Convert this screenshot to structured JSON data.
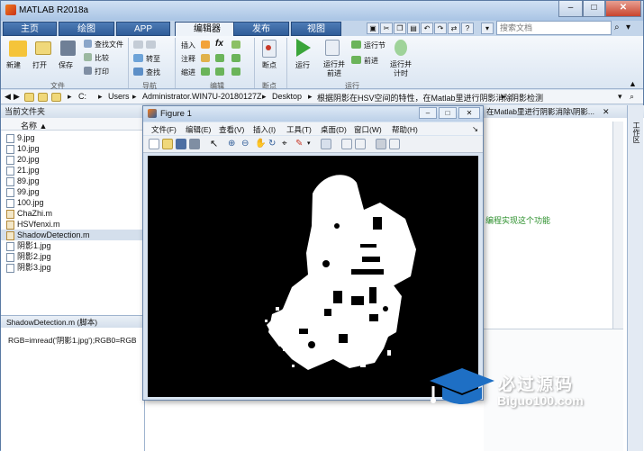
{
  "window": {
    "title": "MATLAB R2018a",
    "min": "–",
    "max": "□",
    "close": "✕"
  },
  "tabs": [
    {
      "label": "主页"
    },
    {
      "label": "绘图"
    },
    {
      "label": "APP"
    },
    {
      "label": "编辑器"
    },
    {
      "label": "发布"
    },
    {
      "label": "视图"
    }
  ],
  "search": {
    "placeholder": "搜索文档"
  },
  "ribbon": {
    "file": {
      "new": "新建",
      "open": "打开",
      "save": "保存",
      "find_files": "查找文件",
      "compare": "比较",
      "print": "打印",
      "group": "文件"
    },
    "navigate": {
      "goto": "转至",
      "find": "查找",
      "group": "导航"
    },
    "edit": {
      "insert": "插入",
      "comment": "注释",
      "indent": "缩进",
      "fx": "fx",
      "group": "编辑"
    },
    "breakpoints": {
      "label": "断点",
      "group": "断点"
    },
    "run": {
      "run": "运行",
      "run_advance": "运行并前进",
      "run_section": "运行节",
      "advance": "前进",
      "run_time": "运行并计时",
      "group": "运行"
    }
  },
  "address": [
    "C:",
    "Users",
    "Administrator.WIN7U-20180127Z",
    "Desktop",
    "根据阴影在HSV空间的特性，在Matlab里进行阴影消除",
    "阴影检测"
  ],
  "current_folder": {
    "header": "当前文件夹",
    "col": "名称 ▲",
    "files": [
      {
        "name": "9.jpg",
        "type": "img"
      },
      {
        "name": "10.jpg",
        "type": "img"
      },
      {
        "name": "20.jpg",
        "type": "img"
      },
      {
        "name": "21.jpg",
        "type": "img"
      },
      {
        "name": "89.jpg",
        "type": "img"
      },
      {
        "name": "99.jpg",
        "type": "img"
      },
      {
        "name": "100.jpg",
        "type": "img"
      },
      {
        "name": "ChaZhi.m",
        "type": "m"
      },
      {
        "name": "HSVfenxi.m",
        "type": "m"
      },
      {
        "name": "ShadowDetection.m",
        "type": "m"
      },
      {
        "name": "阴影1.jpg",
        "type": "img"
      },
      {
        "name": "阴影2.jpg",
        "type": "img"
      },
      {
        "name": "阴影3.jpg",
        "type": "img"
      }
    ],
    "selected": "ShadowDetection.m"
  },
  "details": {
    "header": "ShadowDetection.m  (脚本)",
    "code": "RGB=imread('阴影1.jpg');RGB0=RGB"
  },
  "editor": {
    "tab_path": "在Matlab里进行阴影消除\\阴影...",
    "comment": "编程实现这个功能"
  },
  "side_tab": "工作区",
  "figure": {
    "title": "Figure 1",
    "menu": [
      "文件(F)",
      "编辑(E)",
      "查看(V)",
      "插入(I)",
      "工具(T)",
      "桌面(D)",
      "窗口(W)",
      "帮助(H)"
    ]
  },
  "watermark": {
    "line1": "必过源码",
    "line2": "Biguo100.com"
  },
  "colors": {
    "accent": "#2f5c98",
    "figure_bg": "#000000"
  }
}
